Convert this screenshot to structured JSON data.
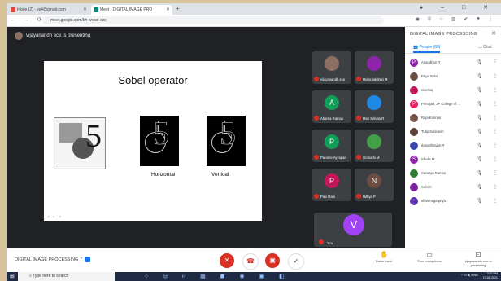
{
  "browser": {
    "tabs": [
      {
        "label": "Inbox (2) - vs4@gmail.com"
      },
      {
        "label": "Meet - DIGITAL IMAGE PRO"
      }
    ],
    "new_tab": "+",
    "url": "meet.google.com/kfr-wvwd-csc"
  },
  "meet": {
    "presenting": "vijayanandh ece is presenting",
    "slide": {
      "title": "Sobel operator",
      "caption_horizontal": "Horizontal",
      "caption_vertical": "Vertical"
    },
    "tiles": [
      {
        "name": "vijayanandh ece",
        "initial": "",
        "color": "#8d6e63"
      },
      {
        "name": "Maha lakshmi M",
        "initial": "",
        "color": "#8e24aa"
      },
      {
        "name": "Abarna Raman",
        "initial": "A",
        "color": "#0f9d58"
      },
      {
        "name": "Mari Selvan R",
        "initial": "",
        "color": "#1e88e5"
      },
      {
        "name": "Parame Ayyapan",
        "initial": "P",
        "color": "#0f9d58"
      },
      {
        "name": "Gomathi M",
        "initial": "",
        "color": "#43a047"
      },
      {
        "name": "Pavi Rani",
        "initial": "P",
        "color": "#c2185b"
      },
      {
        "name": "Nithya P",
        "initial": "N",
        "color": "#6d4c41"
      }
    ],
    "self_tile": {
      "name": "You",
      "initial": "V"
    }
  },
  "panel": {
    "title": "DIGITAL IMAGE PROCESSING",
    "tab_people": "People (69)",
    "tab_chat": "Chat",
    "people": [
      {
        "name": "Anandhan R",
        "initial": "P",
        "color": "#8e24aa"
      },
      {
        "name": "Priya Selvi",
        "initial": "",
        "color": "#6d4c41"
      },
      {
        "name": "nivethaj",
        "initial": "",
        "color": "#c2185b"
      },
      {
        "name": "Principal, JP College of ...",
        "initial": "P",
        "color": "#e91e63"
      },
      {
        "name": "Raja Kannan",
        "initial": "",
        "color": "#795548"
      },
      {
        "name": "Tulip Sabinesh",
        "initial": "",
        "color": "#5d4037"
      },
      {
        "name": "damathirajan R",
        "initial": "",
        "color": "#3949ab"
      },
      {
        "name": "Sheila M",
        "initial": "S",
        "color": "#8e24aa"
      },
      {
        "name": "Saranya Raman",
        "initial": "",
        "color": "#2e7d32"
      },
      {
        "name": "Selvi K",
        "initial": "",
        "color": "#7b1fa2"
      },
      {
        "name": "shanmuga priya",
        "initial": "",
        "color": "#5e35b1"
      }
    ]
  },
  "bottom": {
    "meeting_name": "DIGITAL IMAGE PROCESSING",
    "raise_hand": "Raise hand",
    "captions": "Turn on captions",
    "presenting": "vijayanandh ece is presenting"
  },
  "taskbar": {
    "search": "Type here to search",
    "lang": "ENG",
    "time": "12:02 PM",
    "date": "13-05-2021"
  }
}
